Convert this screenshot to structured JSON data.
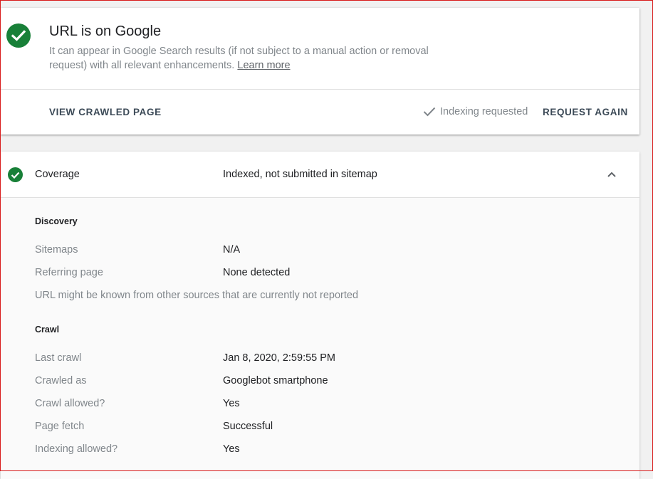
{
  "status": {
    "title": "URL is on Google",
    "description": "It can appear in Google Search results (if not subject to a manual action or removal request) with all relevant enhancements. ",
    "learn_more": "Learn more",
    "icon": "check-circle-icon",
    "color": "#188038"
  },
  "actions": {
    "view_crawled": "VIEW CRAWLED PAGE",
    "indexing_requested": "Indexing requested",
    "request_again": "REQUEST AGAIN"
  },
  "coverage": {
    "label": "Coverage",
    "value": "Indexed, not submitted in sitemap"
  },
  "discovery": {
    "title": "Discovery",
    "rows": [
      {
        "label": "Sitemaps",
        "value": "N/A"
      },
      {
        "label": "Referring page",
        "value": "None detected"
      }
    ],
    "note": "URL might be known from other sources that are currently not reported"
  },
  "crawl": {
    "title": "Crawl",
    "rows": [
      {
        "label": "Last crawl",
        "value": "Jan 8, 2020, 2:59:55 PM"
      },
      {
        "label": "Crawled as",
        "value": "Googlebot smartphone"
      },
      {
        "label": "Crawl allowed?",
        "value": "Yes"
      },
      {
        "label": "Page fetch",
        "value": "Successful"
      },
      {
        "label": "Indexing allowed?",
        "value": "Yes"
      }
    ]
  }
}
